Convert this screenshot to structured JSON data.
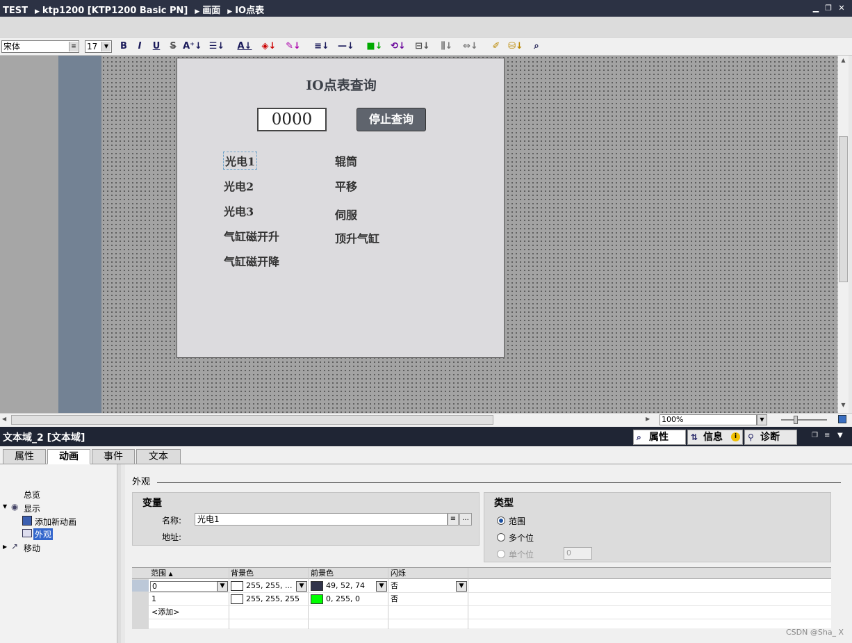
{
  "titlebar": {
    "crumbs": [
      "TEST",
      "ktp1200 [KTP1200 Basic PN]",
      "画面",
      "IO点表"
    ]
  },
  "toolbar": {
    "font_name": "宋体",
    "font_size": "17"
  },
  "screen": {
    "title": "IO点表查询",
    "number_value": "0000",
    "stop_button": "停止查询",
    "left_items": [
      "光电1",
      "光电2",
      "光电3",
      "气缸磁开升",
      "气缸磁开降"
    ],
    "right_items": [
      "辊筒",
      "平移",
      "伺服",
      "顶升气缸"
    ]
  },
  "zoom": {
    "value": "100%"
  },
  "inspector": {
    "title": "文本域_2 [文本域]",
    "right_tabs": [
      "属性",
      "信息",
      "诊断"
    ],
    "tabs": [
      "属性",
      "动画",
      "事件",
      "文本"
    ],
    "tree": {
      "overview": "总览",
      "display": "显示",
      "add_animation": "添加新动画",
      "appearance": "外观",
      "move": "移动"
    },
    "section_title": "外观",
    "variable": {
      "header": "变量",
      "name_label": "名称:",
      "name_value": "光电1",
      "address_label": "地址:"
    },
    "type": {
      "header": "类型",
      "options": [
        "范围",
        "多个位",
        "单个位"
      ],
      "bit_value": "0"
    },
    "grid": {
      "columns": [
        "范围",
        "背景色",
        "前景色",
        "闪烁"
      ],
      "rows": [
        {
          "range": "0",
          "bg": "255, 255, ...",
          "fg": "49, 52, 74",
          "blink": "否",
          "bg_color": "#ffffff",
          "fg_color": "#31344a"
        },
        {
          "range": "1",
          "bg": "255, 255, 255",
          "fg": "0, 255, 0",
          "blink": "否",
          "bg_color": "#ffffff",
          "fg_color": "#00ff00"
        }
      ],
      "add_label": "<添加>"
    }
  },
  "watermark": "CSDN @Sha_ X"
}
